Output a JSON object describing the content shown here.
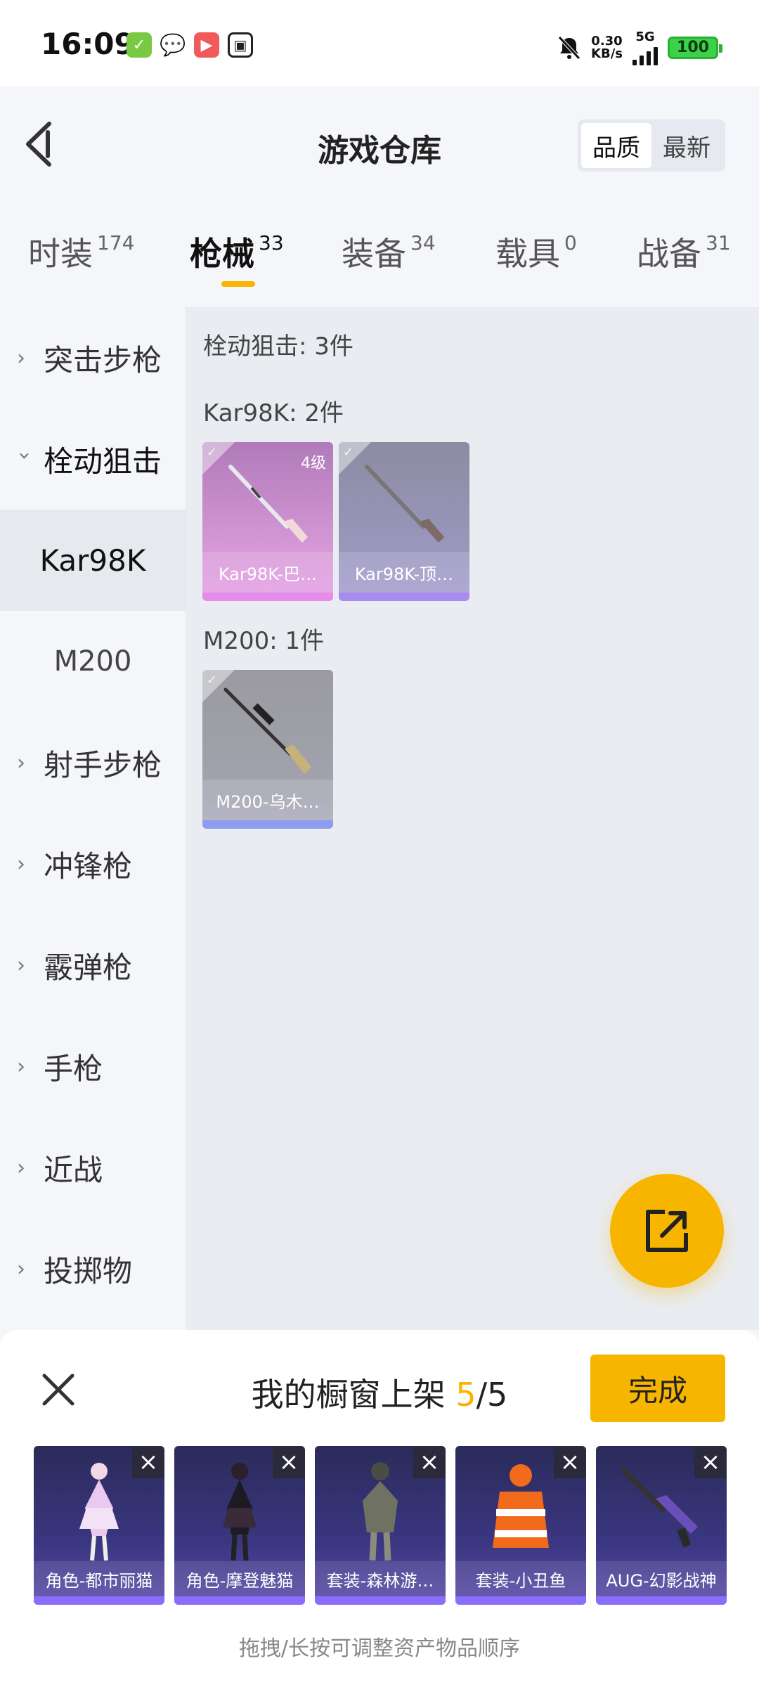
{
  "status": {
    "time": "16:09",
    "speed_value": "0.30",
    "speed_unit": "KB/s",
    "network": "5G",
    "battery": "100"
  },
  "header": {
    "title": "游戏仓库",
    "sort": [
      "品质",
      "最新"
    ]
  },
  "tabs": [
    {
      "label": "时装",
      "count": "174"
    },
    {
      "label": "枪械",
      "count": "33"
    },
    {
      "label": "装备",
      "count": "34"
    },
    {
      "label": "载具",
      "count": "0"
    },
    {
      "label": "战备",
      "count": "31"
    }
  ],
  "sidebar": {
    "cats": [
      "突击步枪",
      "栓动狙击",
      "射手步枪",
      "冲锋枪",
      "霰弹枪",
      "手枪",
      "近战",
      "投掷物"
    ],
    "subs": [
      "Kar98K",
      "M200"
    ]
  },
  "content": {
    "summary": "栓动狙击: 3件",
    "groups": [
      {
        "title": "Kar98K: 2件",
        "items": [
          {
            "name": "Kar98K-巴…",
            "level": "4级"
          },
          {
            "name": "Kar98K-顶…"
          }
        ]
      },
      {
        "title": "M200: 1件",
        "items": [
          {
            "name": "M200-乌木…"
          }
        ]
      }
    ]
  },
  "sheet": {
    "title_prefix": "我的橱窗上架",
    "count": "5",
    "total": "/5",
    "done": "完成",
    "items": [
      "角色-都市丽猫",
      "角色-摩登魅猫",
      "套装-森林游…",
      "套装-小丑鱼",
      "AUG-幻影战神"
    ],
    "hint": "拖拽/长按可调整资产物品顺序"
  }
}
